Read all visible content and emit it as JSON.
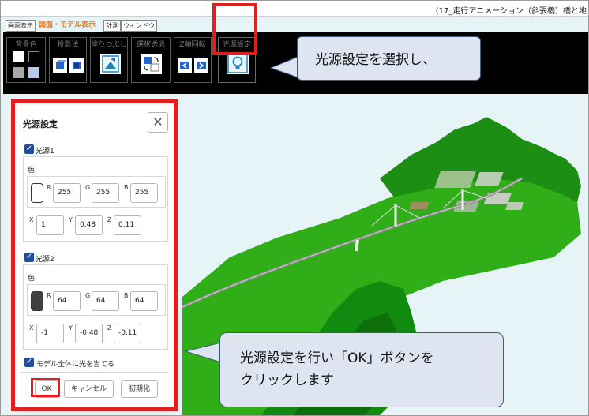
{
  "window": {
    "title": "(17_走行アニメーション（斜張橋）橋と地"
  },
  "menu": {
    "tabs": [
      {
        "label": "画面表示",
        "active": false
      },
      {
        "label": "図面・モデル表示",
        "active": true
      },
      {
        "label": "計測",
        "active": false
      },
      {
        "label": "ウィンドウ",
        "active": false
      }
    ]
  },
  "toolbar": {
    "groups": [
      {
        "label": "背景色",
        "icon": "background-color-swatches"
      },
      {
        "label": "投影法",
        "icon": "projection-cube-icon"
      },
      {
        "label": "塗りつぶし",
        "icon": "fill-icon"
      },
      {
        "label": "選択透過",
        "icon": "selection-transparency-icon"
      },
      {
        "label": "Z軸回転",
        "icon": "z-axis-rotate-icon"
      },
      {
        "label": "光源設定",
        "icon": "light-bulb-icon"
      }
    ],
    "colors": {
      "bg": "#000000",
      "button": "#ffffff",
      "highlight": "#e02020"
    }
  },
  "callouts": {
    "top": "光源設定を選択し、",
    "bottom_line1": "光源設定を行い「OK」ボタンを",
    "bottom_line2": "クリックします"
  },
  "dialog": {
    "title": "光源設定",
    "close_symbol": "✕",
    "light1": {
      "label": "光源1",
      "checked": true,
      "color_label": "色",
      "swatch_color": "#ffffff",
      "r_label": "R",
      "r": "255",
      "g_label": "G",
      "g": "255",
      "b_label": "B",
      "b": "255",
      "x_label": "X",
      "x": "1",
      "y_label": "Y",
      "y": "0.48",
      "z_label": "Z",
      "z": "0.11"
    },
    "light2": {
      "label": "光源2",
      "checked": true,
      "color_label": "色",
      "swatch_color": "#404040",
      "r_label": "R",
      "r": "64",
      "g_label": "G",
      "g": "64",
      "b_label": "B",
      "b": "64",
      "x_label": "X",
      "x": "-1",
      "y_label": "Y",
      "y": "-0.48",
      "z_label": "Z",
      "z": "-0.11"
    },
    "apply_all": {
      "label": "モデル全体に光を当てる",
      "checked": true
    },
    "buttons": {
      "ok": "OK",
      "cancel": "キャンセル",
      "reset": "初期化"
    }
  },
  "scene": {
    "sky": "#e6f3f7",
    "terrain": "#2fae18",
    "terrain_dark": "#0f7a0c"
  }
}
